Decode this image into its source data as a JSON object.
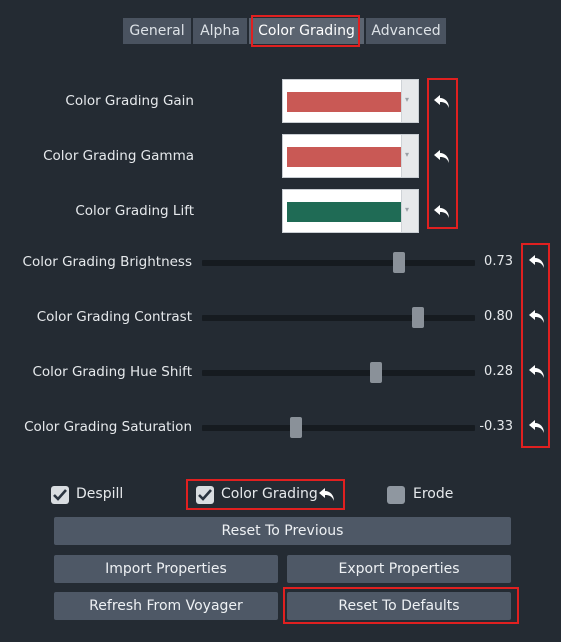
{
  "tabs": [
    "General",
    "Alpha",
    "Color Grading",
    "Advanced"
  ],
  "active_tab": "Color Grading",
  "color_rows": [
    {
      "label": "Color Grading Gain",
      "color": "#c95955"
    },
    {
      "label": "Color Grading Gamma",
      "color": "#c95955"
    },
    {
      "label": "Color Grading Lift",
      "color": "#1f6b55"
    }
  ],
  "slider_rows": [
    {
      "label": "Color Grading Brightness",
      "value": "0.73"
    },
    {
      "label": "Color Grading Contrast",
      "value": "0.80"
    },
    {
      "label": "Color Grading Hue Shift",
      "value": "0.28"
    },
    {
      "label": "Color Grading Saturation",
      "value": "-0.33"
    }
  ],
  "checkboxes": [
    {
      "label": "Despill",
      "checked": true
    },
    {
      "label": "Color Grading",
      "checked": true
    },
    {
      "label": "Erode",
      "checked": false
    }
  ],
  "buttons": {
    "reset_previous": "Reset To Previous",
    "import": "Import Properties",
    "export": "Export Properties",
    "refresh": "Refresh From Voyager",
    "reset_defaults": "Reset To Defaults"
  },
  "colors": {
    "background": "#242b33",
    "highlight": "#e02020"
  },
  "icons": {
    "undo": "undo-arrow-icon",
    "check": "checkmark-icon",
    "dropdown": "chevron-down-icon"
  }
}
